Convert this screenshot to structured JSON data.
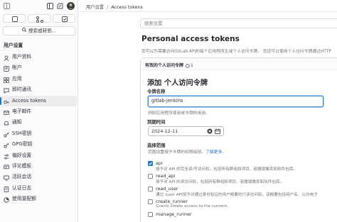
{
  "breadcrumb": {
    "parent": "用户设置",
    "current": "Access tokens"
  },
  "sidebar": {
    "search_label": "搜索或转到...",
    "section_heading": "用户设置",
    "items": [
      {
        "label": "用户资料",
        "icon": "user-icon"
      },
      {
        "label": "帐户",
        "icon": "account-icon"
      },
      {
        "label": "应用",
        "icon": "applications-icon"
      },
      {
        "label": "即时通讯",
        "icon": "chat-icon"
      },
      {
        "label": "Access tokens",
        "icon": "token-icon",
        "active": true
      },
      {
        "label": "电子邮件",
        "icon": "mail-icon"
      },
      {
        "label": "通知",
        "icon": "notifications-icon"
      },
      {
        "label": "SSH密钥",
        "icon": "key-icon"
      },
      {
        "label": "GPG密钥",
        "icon": "key-icon"
      },
      {
        "label": "偏好设置",
        "icon": "preferences-icon"
      },
      {
        "label": "评论模板",
        "icon": "comment-template-icon"
      },
      {
        "label": "活跃会话",
        "icon": "sessions-icon"
      },
      {
        "label": "认证日志",
        "icon": "log-icon"
      },
      {
        "label": "使用量配额",
        "icon": "quota-icon"
      }
    ]
  },
  "main": {
    "search_placeholder": "搜索设置",
    "title": "Personal access tokens",
    "description": "您可以为需要访问GitLab API的每个应用程序生成个人访问令牌。 您还可以使用个人访问令牌通过HTTP",
    "card": {
      "header_label": "有效的个人访问令牌",
      "header_count": "1"
    },
    "form": {
      "title": "添加 个人访问令牌",
      "name_label": "令牌名称",
      "name_value": "gitlab-jenkins",
      "name_help": "例如应用程序使用或令牌的用途。",
      "expiry_label": "到期时间",
      "expiry_value": "2024-12-11",
      "scopes_label": "选择范围",
      "scopes_help": "范围设置授予令牌的权限级别。",
      "scopes_help_link": "了解更多。",
      "scopes": [
        {
          "name": "api",
          "desc": "授予对 API 的完全读/写访问权，包括所有群组和项目、容器镜像库和软件包库。",
          "checked": true
        },
        {
          "name": "read_api",
          "desc": "授予对 API 的读访问权，包括所有群组和项目、容器镜像库和软件包库。",
          "checked": false
        },
        {
          "name": "read_user",
          "desc": "通过 /user API授予对通过身份验证的用户概要的只读访问权，该概要包括用户名、公共电子",
          "checked": false
        },
        {
          "name": "create_runner",
          "desc": "Grants create access to the runners.",
          "checked": false
        },
        {
          "name": "manage_runner",
          "desc": "",
          "checked": false
        }
      ]
    }
  },
  "colors": {
    "accent": "#1f75cb",
    "sidebar_bg": "#fbfafd",
    "focus": "#428fdc"
  }
}
